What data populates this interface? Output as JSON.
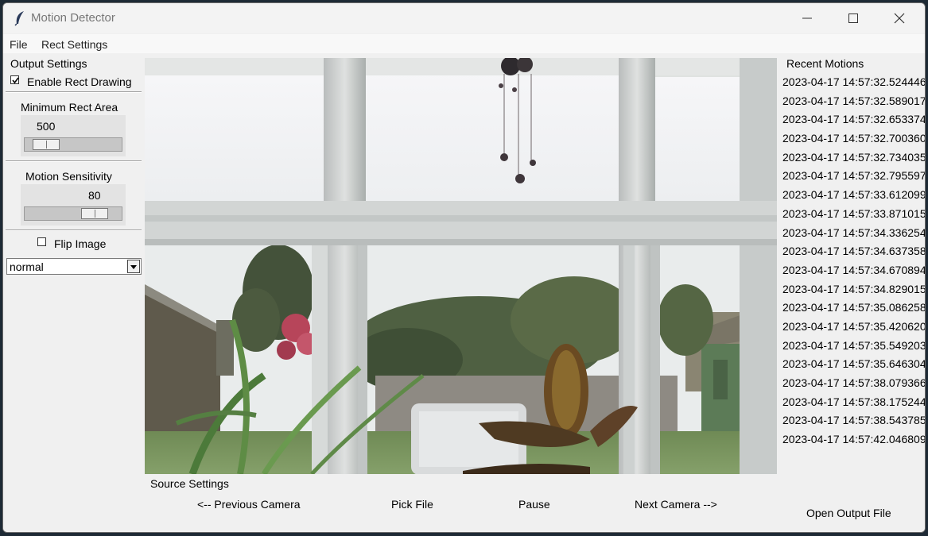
{
  "window": {
    "title": "Motion Detector"
  },
  "menu": [
    {
      "label": "File"
    },
    {
      "label": "Rect Settings"
    }
  ],
  "output_settings": {
    "label": "Output Settings",
    "enable_rect": {
      "label": "Enable Rect Drawing",
      "checked": true
    },
    "min_rect_area": {
      "label": "Minimum Rect Area",
      "value": "500",
      "fraction": 0.1
    },
    "sensitivity": {
      "label": "Motion Sensitivity",
      "value": "80",
      "fraction": 0.8
    },
    "flip": {
      "label": "Flip Image",
      "checked": false
    },
    "mode": {
      "value": "normal"
    }
  },
  "recent": {
    "title": "Recent Motions",
    "items": [
      "2023-04-17 14:57:32.524446",
      "2023-04-17 14:57:32.589017",
      "2023-04-17 14:57:32.653374",
      "2023-04-17 14:57:32.700360",
      "2023-04-17 14:57:32.734035",
      "2023-04-17 14:57:32.795597",
      "2023-04-17 14:57:33.612099",
      "2023-04-17 14:57:33.871015",
      "2023-04-17 14:57:34.336254",
      "2023-04-17 14:57:34.637358",
      "2023-04-17 14:57:34.670894",
      "2023-04-17 14:57:34.829015",
      "2023-04-17 14:57:35.086258",
      "2023-04-17 14:57:35.420620",
      "2023-04-17 14:57:35.549203",
      "2023-04-17 14:57:35.646304",
      "2023-04-17 14:57:38.079366",
      "2023-04-17 14:57:38.175244",
      "2023-04-17 14:57:38.543785",
      "2023-04-17 14:57:42.046809"
    ]
  },
  "source": {
    "label": "Source Settings",
    "prev": "<-- Previous Camera",
    "pick": "Pick File",
    "pause": "Pause",
    "next": "Next Camera -->"
  },
  "open_output": "Open Output File"
}
